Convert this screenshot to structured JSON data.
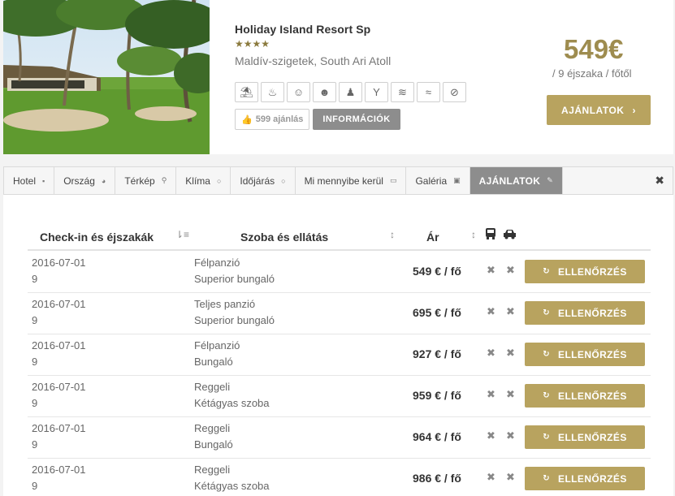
{
  "hotel": {
    "name": "Holiday Island Resort Sp",
    "stars": "★★★★",
    "location": "Maldív-szigetek, South Ari Atoll",
    "amenities": [
      "beach-icon",
      "spa-icon",
      "kids-club-icon",
      "family-icon",
      "wellness-icon",
      "bar-icon",
      "water-sports-icon",
      "pool-icon",
      "no-smoking-icon"
    ],
    "offers_count": "599 ajánlás",
    "info_label": "INFORMÁCIÓK",
    "price": "549€",
    "price_note": "/ 9 éjszaka / főtől",
    "offers_label": "AJÁNLATOK",
    "offers_arrow": "›"
  },
  "tabs": [
    {
      "label": "Hotel",
      "icon": "bookmark-icon",
      "glyph": "▪"
    },
    {
      "label": "Ország",
      "icon": "globe-icon",
      "glyph": "◕"
    },
    {
      "label": "Térkép",
      "icon": "map-pin-icon",
      "glyph": "⚲"
    },
    {
      "label": "Klíma",
      "icon": "clock-icon",
      "glyph": "○"
    },
    {
      "label": "Időjárás",
      "icon": "weather-icon",
      "glyph": "○"
    },
    {
      "label": "Mi mennyibe kerül",
      "icon": "money-icon",
      "glyph": "▭"
    },
    {
      "label": "Galéria",
      "icon": "image-icon",
      "glyph": "▣"
    },
    {
      "label": "AJÁNLATOK",
      "icon": "tag-icon",
      "glyph": "✎",
      "active": true
    }
  ],
  "table": {
    "headers": {
      "checkin": "Check-in és éjszakák",
      "room": "Szoba és ellátás",
      "price": "Ár"
    },
    "rows": [
      {
        "date": "2016-07-01",
        "nights": "9",
        "board": "Félpanzió",
        "room": "Superior bungaló",
        "price": "549 € / fő",
        "action": "ELLENŐRZÉS"
      },
      {
        "date": "2016-07-01",
        "nights": "9",
        "board": "Teljes panzió",
        "room": "Superior bungaló",
        "price": "695 € / fő",
        "action": "ELLENŐRZÉS"
      },
      {
        "date": "2016-07-01",
        "nights": "9",
        "board": "Félpanzió",
        "room": "Bungaló",
        "price": "927 € / fő",
        "action": "ELLENŐRZÉS"
      },
      {
        "date": "2016-07-01",
        "nights": "9",
        "board": "Reggeli",
        "room": "Kétágyas szoba",
        "price": "959 € / fő",
        "action": "ELLENŐRZÉS"
      },
      {
        "date": "2016-07-01",
        "nights": "9",
        "board": "Reggeli",
        "room": "Bungaló",
        "price": "964 € / fő",
        "action": "ELLENŐRZÉS"
      },
      {
        "date": "2016-07-01",
        "nights": "9",
        "board": "Reggeli",
        "room": "Kétágyas szoba",
        "price": "986 € / fő",
        "action": "ELLENŐRZÉS"
      }
    ]
  },
  "colors": {
    "accent": "#b8a35f",
    "price": "#9e8c4f",
    "grey_button": "#8d8d8d"
  }
}
